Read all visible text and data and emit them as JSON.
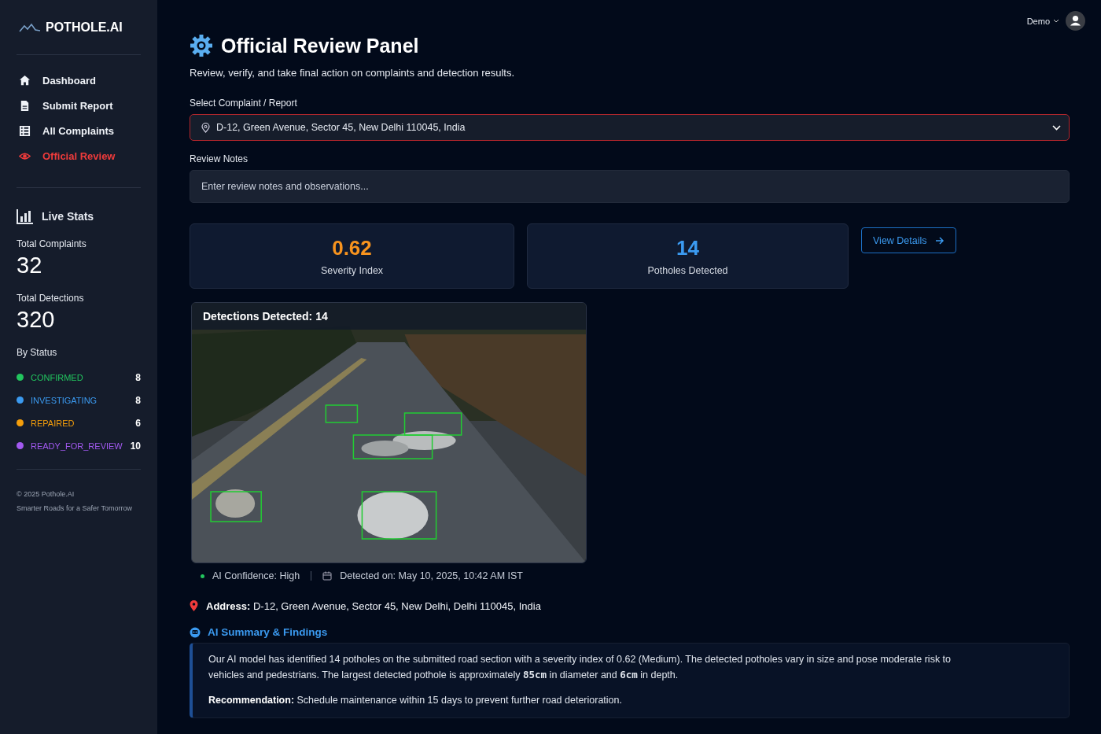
{
  "brand": "POTHOLE.AI",
  "nav": [
    {
      "label": "Dashboard",
      "kind": "home",
      "selected": false
    },
    {
      "label": "Submit Report",
      "kind": "file",
      "selected": false
    },
    {
      "label": "All Complaints",
      "kind": "table",
      "selected": false
    },
    {
      "label": "Official Review",
      "kind": "eye",
      "selected": true
    }
  ],
  "live_stats": {
    "title": "Live Stats",
    "total_complaints_label": "Total Complaints",
    "total_complaints": "32",
    "total_detections_label": "Total Detections",
    "total_detections": "320",
    "by_status_label": "By Status",
    "statuses": [
      {
        "name": "CONFIRMED",
        "count": "8",
        "color": "#22c55e"
      },
      {
        "name": "INVESTIGATING",
        "count": "8",
        "color": "#3b9af0"
      },
      {
        "name": "REPAIRED",
        "count": "6",
        "color": "#f59e0b"
      },
      {
        "name": "READY_FOR_REVIEW",
        "count": "10",
        "color": "#a259f0"
      }
    ]
  },
  "footer": {
    "copyright": "© 2025 Pothole.AI",
    "tagline": "Smarter Roads for a Safer Tomorrow"
  },
  "user": {
    "name": "Demo"
  },
  "title": "Official Review Panel",
  "subtitle": "Review, verify, and take final action on complaints and detection results.",
  "complaint_select": {
    "label": "Select Complaint / Report",
    "value": "D-12, Green Avenue, Sector 45, New Delhi 110045, India"
  },
  "review_notes": {
    "label": "Review Notes",
    "placeholder": "Enter review notes and observations..."
  },
  "metrics": [
    {
      "value": "0.62",
      "label": "Severity Index",
      "color": "#f7931e"
    },
    {
      "value": "14",
      "label": "Potholes Detected",
      "color": "#3b9af0"
    }
  ],
  "view_details": "View Details",
  "detection_image": {
    "title": "Detections Detected: 14",
    "kind": "picture"
  },
  "confidence": "AI Confidence: High",
  "detected_on": "Detected on: May 10, 2025, 10:42 AM IST",
  "address": "**Address:** D-12, Green Avenue, Sector 45, New Delhi, Delhi 110045, India",
  "summary": {
    "title": "AI Summary & Findings",
    "text": "Our AI model has identified 14 potholes on the submitted road section with a severity index of 0.62 (Medium). The detected potholes vary in size and pose moderate risk to vehicles and pedestrians. The largest detected pothole is approximately **85cm** in diameter and **6cm** in depth.",
    "recommendation": "**Recommendation:** Schedule maintenance within 15 days to prevent further road deterioration."
  }
}
